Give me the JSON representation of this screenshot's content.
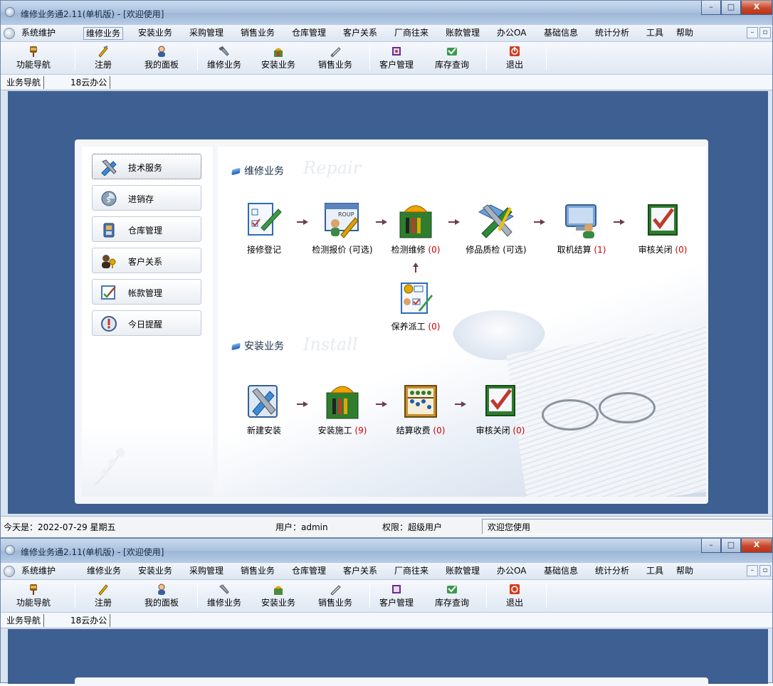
{
  "window": {
    "title": "维修业务通2.11(单机版) - [欢迎使用]",
    "buttons": {
      "minimize": "–",
      "maximize": "□",
      "close": "X"
    }
  },
  "menubar": {
    "items": [
      "系统维护",
      "维修业务",
      "安装业务",
      "采购管理",
      "销售业务",
      "仓库管理",
      "客户关系",
      "厂商往来",
      "账款管理",
      "办公OA",
      "基础信息",
      "统计分析",
      "工具",
      "帮助"
    ],
    "active_index": 1,
    "mdi_minimize": "–",
    "mdi_restore": "▫"
  },
  "toolbar": {
    "items": [
      {
        "label": "功能导航",
        "icon": "navigation-icon"
      },
      {
        "label": "注册",
        "icon": "register-icon"
      },
      {
        "label": "我的面板",
        "icon": "user-panel-icon"
      },
      {
        "label": "维修业务",
        "icon": "repair-icon"
      },
      {
        "label": "安装业务",
        "icon": "install-icon"
      },
      {
        "label": "销售业务",
        "icon": "sales-icon"
      },
      {
        "label": "客户管理",
        "icon": "customer-icon"
      },
      {
        "label": "库存查询",
        "icon": "inventory-icon"
      },
      {
        "label": "退出",
        "icon": "exit-icon"
      }
    ]
  },
  "tabs": [
    "业务导航",
    "18云办公"
  ],
  "leftnav": {
    "items": [
      {
        "label": "技术服务",
        "icon": "tech-service-icon",
        "selected": true
      },
      {
        "label": "进销存",
        "icon": "purchase-sales-icon",
        "selected": false
      },
      {
        "label": "仓库管理",
        "icon": "warehouse-icon",
        "selected": false
      },
      {
        "label": "客户关系",
        "icon": "customer-relation-icon",
        "selected": false
      },
      {
        "label": "帐款管理",
        "icon": "account-icon",
        "selected": false
      },
      {
        "label": "今日提醒",
        "icon": "reminder-icon",
        "selected": false
      }
    ]
  },
  "repair": {
    "title": "维修业务",
    "watermark": "Repair",
    "steps": [
      {
        "label": "接修登记",
        "count": "",
        "icon": "intake-form-icon"
      },
      {
        "label": "检测报价 (可选)",
        "count": "",
        "icon": "quote-icon"
      },
      {
        "label": "检测维修 ",
        "count": "(0)",
        "icon": "repair-toolbox-icon"
      },
      {
        "label": "修品质检 (可选)",
        "count": "",
        "icon": "quality-check-icon"
      },
      {
        "label": "取机结算 ",
        "count": "(1)",
        "icon": "pickup-settle-icon"
      },
      {
        "label": "审核关闭 ",
        "count": "(0)",
        "icon": "audit-close-icon"
      }
    ],
    "maintenance": {
      "label": "保养派工 ",
      "count": "(0)",
      "icon": "maintenance-dispatch-icon"
    }
  },
  "install": {
    "title": "安装业务",
    "watermark": "Install",
    "steps": [
      {
        "label": "新建安装",
        "count": "",
        "icon": "new-install-icon"
      },
      {
        "label": "安装施工 ",
        "count": "(9)",
        "icon": "install-work-icon"
      },
      {
        "label": "结算收费 ",
        "count": "(0)",
        "icon": "abacus-icon"
      },
      {
        "label": "审核关闭 ",
        "count": "(0)",
        "icon": "audit-close-icon"
      }
    ]
  },
  "statusbar": {
    "date": "今天是：2022-07-29 星期五",
    "user": "用户：admin",
    "role": "权限：超级用户",
    "welcome": "欢迎您使用"
  },
  "colors": {
    "workspace": "#3d5f91",
    "count_red": "#cc0000"
  }
}
